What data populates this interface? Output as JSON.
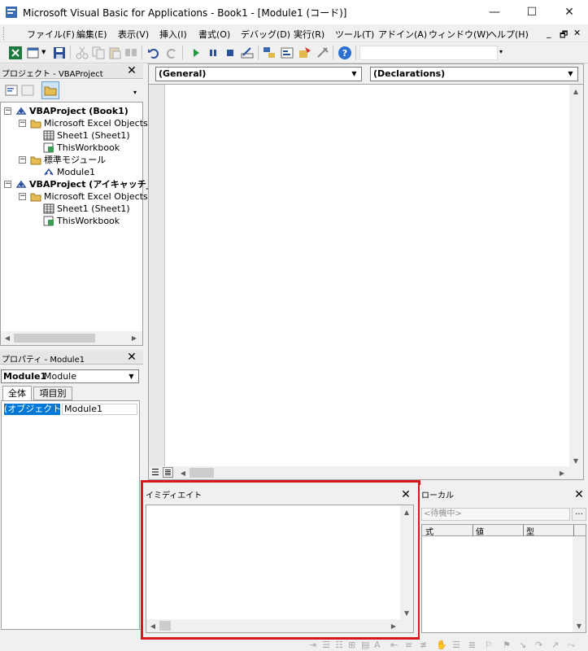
{
  "window": {
    "title": "Microsoft Visual Basic for Applications - Book1 - [Module1 (コード)]",
    "controls": {
      "minimize": "—",
      "maximize": "☐",
      "close": "✕"
    }
  },
  "menubar": {
    "items": [
      "ファイル(F)",
      "編集(E)",
      "表示(V)",
      "挿入(I)",
      "書式(O)",
      "デバッグ(D)",
      "実行(R)",
      "ツール(T)",
      "アドイン(A)",
      "ウィンドウ(W)",
      "ヘルプ(H)"
    ],
    "child_controls": {
      "minimize": "_",
      "restore": "🗗",
      "close": "✕"
    }
  },
  "toolbar": {
    "icons": [
      "excel-icon",
      "insert-module-icon",
      "save-icon",
      "cut-icon",
      "copy-icon",
      "paste-icon",
      "find-icon",
      "undo-icon",
      "redo-icon",
      "run-icon",
      "break-icon",
      "reset-icon",
      "design-mode-icon",
      "project-explorer-icon",
      "properties-icon",
      "object-browser-icon",
      "toolbox-icon",
      "help-icon"
    ]
  },
  "project": {
    "title": "プロジェクト - VBAProject",
    "tree": [
      {
        "level": 0,
        "label": "VBAProject (Book1)",
        "bold": true,
        "icon": "vba-project-icon",
        "expander": "−"
      },
      {
        "level": 1,
        "label": "Microsoft Excel Objects",
        "bold": false,
        "icon": "folder-icon",
        "expander": "−"
      },
      {
        "level": 2,
        "label": "Sheet1 (Sheet1)",
        "bold": false,
        "icon": "sheet-icon",
        "expander": ""
      },
      {
        "level": 2,
        "label": "ThisWorkbook",
        "bold": false,
        "icon": "workbook-icon",
        "expander": ""
      },
      {
        "level": 1,
        "label": "標準モジュール",
        "bold": false,
        "icon": "folder-icon",
        "expander": "−"
      },
      {
        "level": 2,
        "label": "Module1",
        "bold": false,
        "icon": "module-icon",
        "expander": ""
      },
      {
        "level": 0,
        "label": "VBAProject (アイキャッチ_",
        "bold": true,
        "icon": "vba-project-icon",
        "expander": "−"
      },
      {
        "level": 1,
        "label": "Microsoft Excel Objects",
        "bold": false,
        "icon": "folder-icon",
        "expander": "−"
      },
      {
        "level": 2,
        "label": "Sheet1 (Sheet1)",
        "bold": false,
        "icon": "sheet-icon",
        "expander": ""
      },
      {
        "level": 2,
        "label": "ThisWorkbook",
        "bold": false,
        "icon": "workbook-icon",
        "expander": ""
      }
    ]
  },
  "properties": {
    "title": "プロパティ - Module1",
    "object_name": "Module1",
    "object_type": "Module",
    "tabs": [
      "全体",
      "項目別"
    ],
    "rows": [
      {
        "name": "(オブジェクト名)",
        "value": "Module1"
      }
    ]
  },
  "code": {
    "object_combo": "(General)",
    "procedure_combo": "(Declarations)"
  },
  "immediate": {
    "title": "イミディエイト"
  },
  "locals": {
    "title": "ローカル",
    "status": "<待機中>",
    "columns": [
      "式",
      "値",
      "型"
    ],
    "more": "..."
  },
  "colors": {
    "highlight": "#d7191c",
    "selection": "#0078d7"
  }
}
